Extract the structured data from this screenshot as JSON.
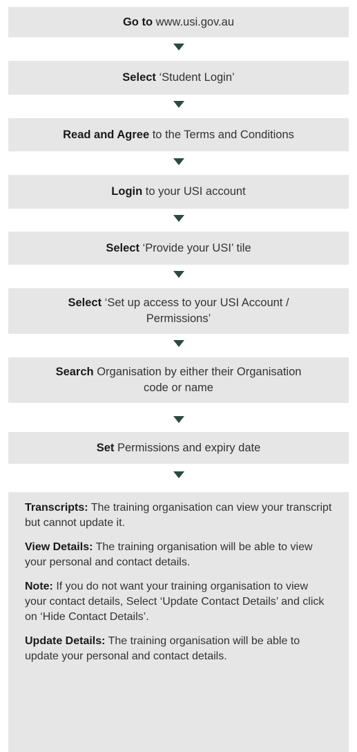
{
  "steps": [
    {
      "keyword": "Go to",
      "text": " www.usi.gov.au"
    },
    {
      "keyword": "Select",
      "text": " ‘Student Login’"
    },
    {
      "keyword": "Read and Agree",
      "text": " to the Terms and Conditions"
    },
    {
      "keyword": "Login",
      "text": " to your USI account"
    },
    {
      "keyword": "Select",
      "text": " ‘Provide your USI’ tile"
    },
    {
      "keyword": "Select",
      "text": " ‘Set up access to your USI Account / Permissions’"
    },
    {
      "keyword": "Search",
      "text": " Organisation by either their Organisation code or name"
    },
    {
      "keyword": "Set",
      "text": " Permissions and expiry date"
    }
  ],
  "info": [
    {
      "keyword": "Transcripts:",
      "text": " The training organisation can view your transcript but cannot update it."
    },
    {
      "keyword": "View Details:",
      "text": " The training organisation will be able to view your personal and contact details."
    },
    {
      "keyword": "Note:",
      "text": " If you do not want your training organisation to view your contact details, Select ‘Update Contact Details’ and click on ‘Hide Contact Details’."
    },
    {
      "keyword": "Update Details:",
      "text": " The training organisation will be able to update your personal and contact details."
    }
  ]
}
